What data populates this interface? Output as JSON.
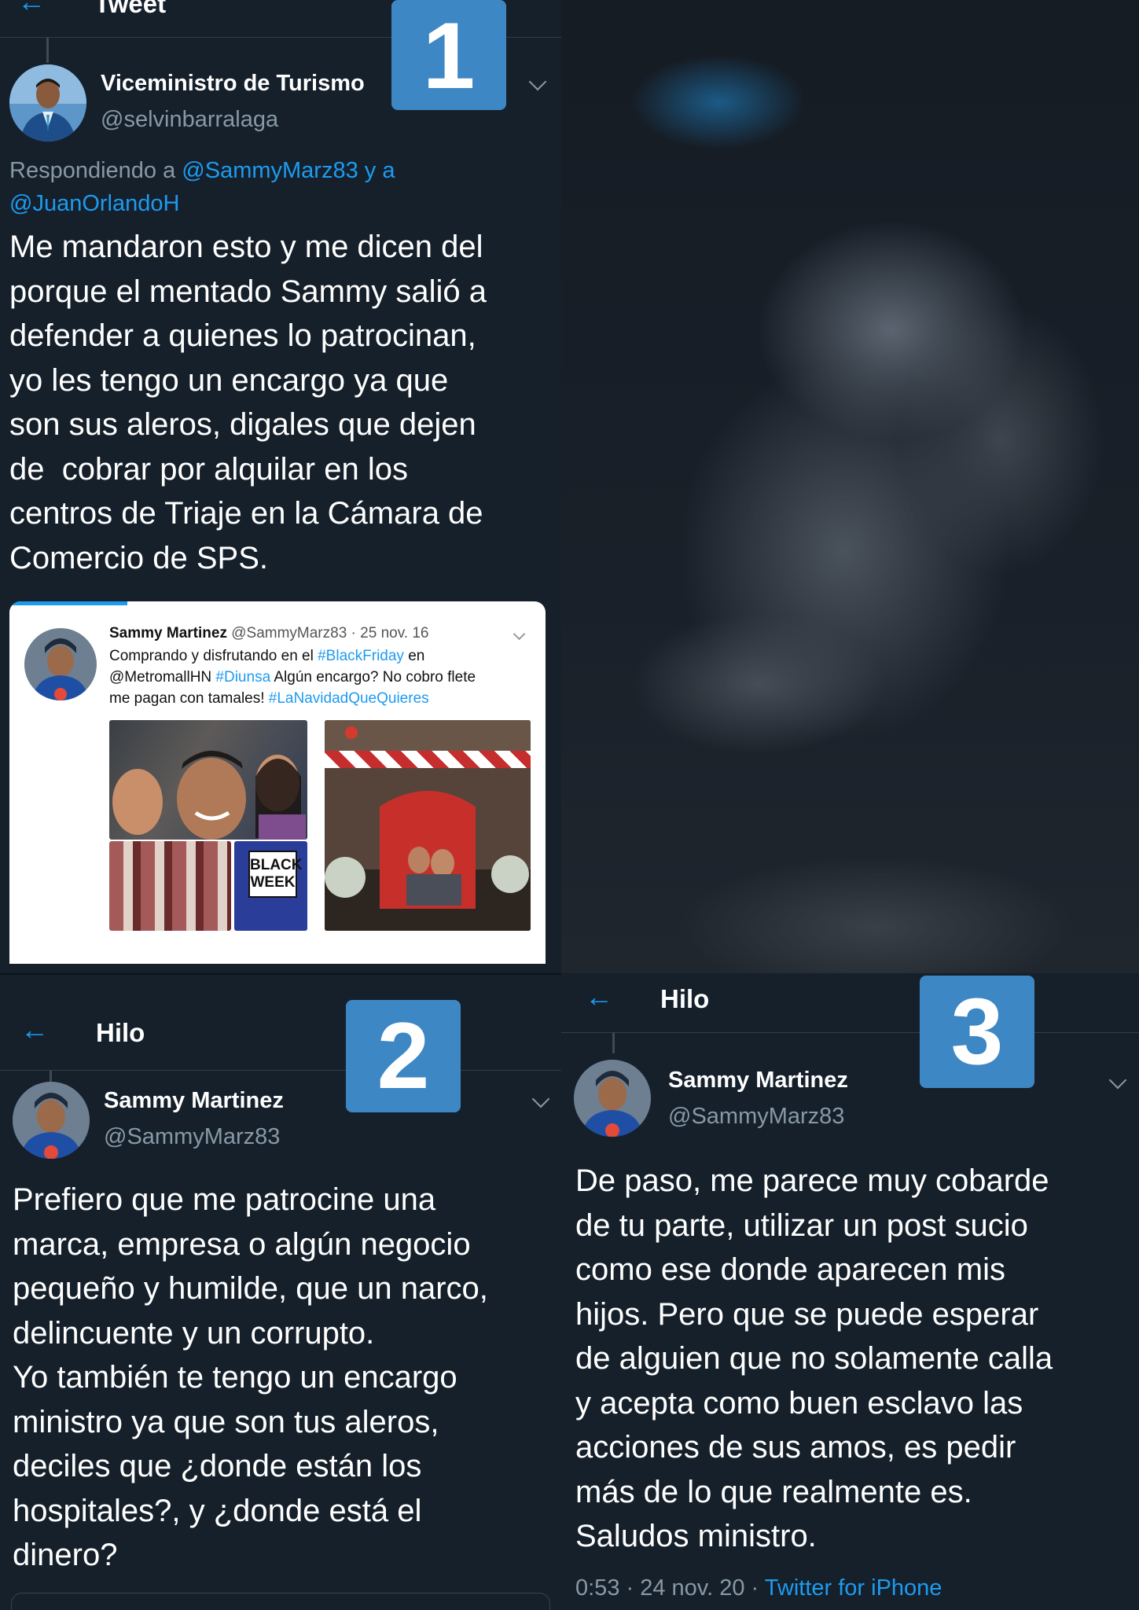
{
  "panel1": {
    "badge": "1",
    "topbar_title": "Tweet",
    "user_name": "Viceministro de Turismo",
    "handle": "@selvinbarralaga",
    "reply_prefix": "Respondiendo a",
    "reply_mention1": "@SammyMarz83",
    "reply_joiner": "y a",
    "reply_mention2": "@JuanOrlandoH",
    "tweet_text": "Me mandaron esto y me dicen del\nporque el mentado Sammy salió a\ndefender a quienes lo patrocinan,\nyo les tengo un encargo ya que\nson sus aleros, digales que dejen\nde  cobrar por alquilar en los\ncentros de Triaje en la Cámara de\nComercio de SPS.",
    "embedded": {
      "name": "Sammy Martinez",
      "handle_date": "@SammyMarz83 · 25 nov. 16",
      "line1_a": "Comprando y disfrutando en el",
      "line1_tag": "#BlackFriday",
      "line1_b": "en",
      "line2_a": "@MetromallHN",
      "line2_tag": "#Diunsa",
      "line2_b": "Algún encargo? No cobro flete",
      "line3_a": "me pagan con tamales!",
      "line3_tag": "#LaNavidadQueQuieres",
      "photo_sign_1": "BLACK",
      "photo_sign_2": "WEEK"
    }
  },
  "panel2": {
    "badge": "2",
    "topbar_title": "Hilo",
    "user_name": "Sammy Martinez",
    "handle": "@SammyMarz83",
    "tweet_text": "Prefiero que me patrocine una\nmarca, empresa o algún negocio\npequeño y humilde, que un narco,\ndelincuente y un corrupto.\nYo también te tengo un encargo\nministro ya que son tus aleros,\ndeciles que ¿donde están los\nhospitales?, y ¿donde está el\ndinero?"
  },
  "panel3": {
    "badge": "3",
    "topbar_title": "Hilo",
    "user_name": "Sammy Martinez",
    "handle": "@SammyMarz83",
    "tweet_text": "De paso, me parece muy cobarde\nde tu parte, utilizar un post sucio\ncomo ese donde aparecen mis\nhijos. Pero que se puede esperar\nde alguien que no solamente calla\ny acepta como buen esclavo las\nacciones de sus amos, es pedir\nmás de lo que realmente es.\nSaludos ministro.",
    "timestamp": "0:53 · 24 nov. 20 ·",
    "source": "Twitter for iPhone"
  },
  "icons": {
    "back": "arrow-left",
    "more": "chevron-down"
  },
  "colors": {
    "background": "#15202b",
    "accent": "#1d9bf0",
    "muted": "#8899a6",
    "badge": "#3d87c5"
  }
}
